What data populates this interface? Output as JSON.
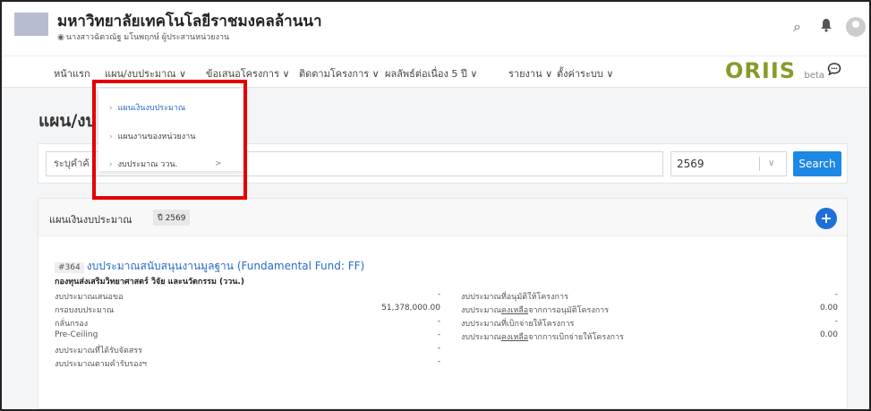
{
  "header": {
    "org_title": "มหาวิทยาลัยเทคโนโลยีราชมงคลล้านนา",
    "user_text": "นางสาวฉัตวณัฐ มโนพฤกษ์ ผู้ประสานหน่วยงาน",
    "user_icon": "user-circle-icon"
  },
  "nav": {
    "items": [
      "หน้าแรก",
      "แผน/งบประมาณ ∨",
      "ข้อเสนอโครงการ ∨",
      "ติดตามโครงการ ∨",
      "ผลลัพธ์ต่อเนื่อง 5 ปี ∨",
      "รายงาน ∨",
      "ตั้งค่าระบบ ∨"
    ],
    "brand": "ORIIS",
    "brand_beta": "beta"
  },
  "dropdown": {
    "items": [
      "แผนเงินงบประมาณ",
      "แผนงานของหน่วยงาน",
      "งบประมาณ ววน."
    ],
    "submenu_arrow": ">"
  },
  "page": {
    "title": "แผน/งบ"
  },
  "search": {
    "placeholder": "ระบุคำค้",
    "year": "2569",
    "button": "Search"
  },
  "card": {
    "title": "แผนเงินงบประมาณ",
    "year_badge": "ปี 2569",
    "fund_number": "#364",
    "fund_name": "งบประมาณสนับสนุนงานมูลฐาน (Fundamental Fund: FF)",
    "fund_org": "กองทุนส่งเสริมวิทยาศาสตร์ วิจัย และนวัตกรรม (ววน.)",
    "left_rows": [
      {
        "label": "งบประมาณเสนอขอ",
        "value": "-"
      },
      {
        "label": "กรอบงบประมาณ",
        "value": "51,378,000.00"
      },
      {
        "label": "กลั่นกรอง",
        "value": "-"
      },
      {
        "label": "Pre-Ceiling",
        "value": "-"
      },
      {
        "label": "งบประมาณที่ได้รับจัดสรร",
        "value": "-"
      },
      {
        "label": "งบประมาณตามคำรับรองฯ",
        "value": "-"
      }
    ],
    "right_rows": [
      {
        "pre": "งบประมาณที่อนุมัติให้โครงการ",
        "ul": "",
        "post": "",
        "value": "-"
      },
      {
        "pre": "งบประมาณ",
        "ul": "คงเหลือ",
        "post": "จากการอนุมัติโครงการ",
        "value": "0.00"
      },
      {
        "pre": "งบประมาณที่เบิกจ่ายให้โครงการ",
        "ul": "",
        "post": "",
        "value": "-"
      },
      {
        "pre": "งบประมาณ",
        "ul": "คงเหลือ",
        "post": "จากการเบิกจ่ายให้โครงการ",
        "value": "0.00"
      }
    ]
  },
  "colors": {
    "accent": "#1e88e5",
    "highlight": "#e30000",
    "brand_olive": "#8a9a2a",
    "brand_navy": "#1a3a8a"
  }
}
